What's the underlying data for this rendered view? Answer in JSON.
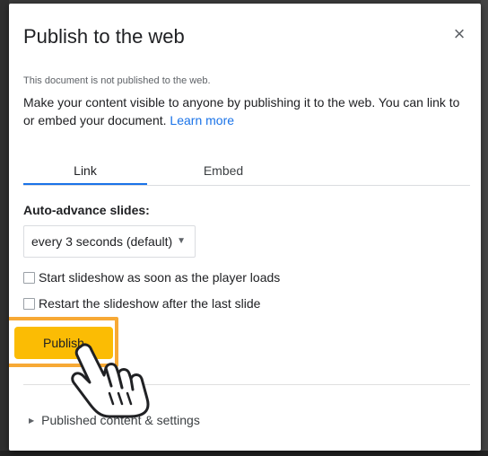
{
  "dialog": {
    "title": "Publish to the web",
    "close_icon_glyph": "×",
    "status_text": "This document is not published to the web.",
    "description_text": "Make your content visible to anyone by publishing it to the web. You can link to or embed your document.",
    "learn_more_label": "Learn more"
  },
  "tabs": [
    {
      "label": "Link",
      "selected": true
    },
    {
      "label": "Embed",
      "selected": false
    }
  ],
  "auto_advance": {
    "label": "Auto-advance slides:",
    "selected_value": "every 3 seconds (default)"
  },
  "options": [
    {
      "label": "Start slideshow as soon as the player loads",
      "checked": false
    },
    {
      "label": "Restart the slideshow after the last slide",
      "checked": false
    }
  ],
  "publish": {
    "label": "Publish",
    "button_color": "#fbbc04",
    "highlight_color": "#f7a935"
  },
  "footer": {
    "published_content_label": "Published content & settings"
  },
  "icons": {
    "close": "close-icon",
    "dropdown": "dropdown-caret-icon",
    "expand": "expand-triangle-icon",
    "cursor": "hand-pointer-icon"
  },
  "colors": {
    "accent_blue": "#1a73e8",
    "text_primary": "#202124",
    "text_secondary": "#5f6368"
  }
}
